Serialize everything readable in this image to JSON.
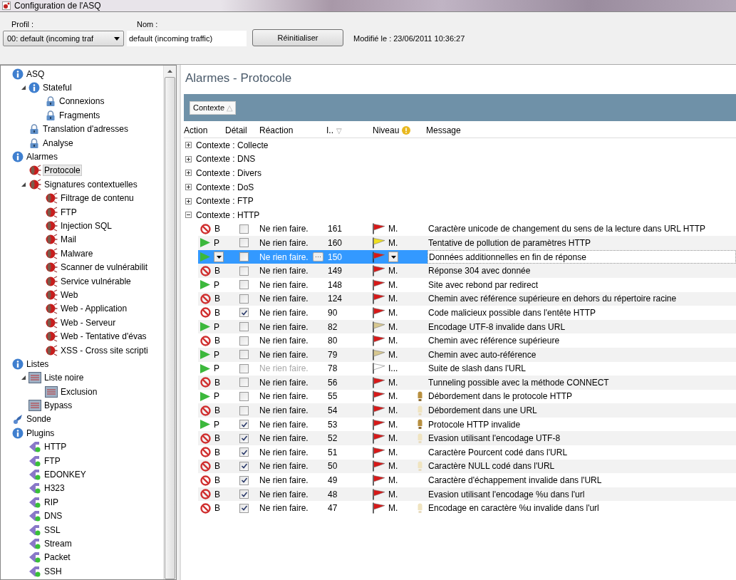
{
  "window": {
    "title": "Configuration de l'ASQ"
  },
  "profile": {
    "profile_label": "Profil :",
    "profile_value": "00: default (incoming traf",
    "name_label": "Nom :",
    "name_value": "default (incoming traffic)",
    "reset_button": "Réinitialiser",
    "modified": "Modifié le : 23/06/2011 10:36:27"
  },
  "tree": [
    {
      "label": "ASQ",
      "kind": "info",
      "selected": false,
      "children": [
        {
          "label": "Stateful",
          "kind": "info",
          "selected": false,
          "expanded": true,
          "children": [
            {
              "label": "Connexions",
              "kind": "lock",
              "selected": false
            },
            {
              "label": "Fragments",
              "kind": "lock",
              "selected": false
            }
          ]
        },
        {
          "label": "Translation d'adresses",
          "kind": "lock",
          "selected": false
        },
        {
          "label": "Analyse",
          "kind": "lock",
          "selected": false
        }
      ]
    },
    {
      "label": "Alarmes",
      "kind": "info",
      "selected": false,
      "children": [
        {
          "label": "Protocole",
          "kind": "alarm",
          "selected": true
        },
        {
          "label": "Signatures contextuelles",
          "kind": "alarm",
          "selected": false,
          "expanded": true,
          "children": [
            {
              "label": "Filtrage de contenu",
              "kind": "alarm",
              "selected": false
            },
            {
              "label": "FTP",
              "kind": "alarm",
              "selected": false
            },
            {
              "label": "Injection SQL",
              "kind": "alarm",
              "selected": false
            },
            {
              "label": "Mail",
              "kind": "alarm",
              "selected": false
            },
            {
              "label": "Malware",
              "kind": "alarm",
              "selected": false
            },
            {
              "label": "Scanner de vulnérabilit",
              "kind": "alarm",
              "selected": false
            },
            {
              "label": "Service vulnérable",
              "kind": "alarm",
              "selected": false
            },
            {
              "label": "Web",
              "kind": "alarm",
              "selected": false
            },
            {
              "label": "Web - Application",
              "kind": "alarm",
              "selected": false
            },
            {
              "label": "Web - Serveur",
              "kind": "alarm",
              "selected": false
            },
            {
              "label": "Web - Tentative d'évas",
              "kind": "alarm",
              "selected": false
            },
            {
              "label": "XSS - Cross site scripti",
              "kind": "alarm",
              "selected": false
            }
          ]
        }
      ]
    },
    {
      "label": "Listes",
      "kind": "info",
      "selected": false,
      "children": [
        {
          "label": "Liste noire",
          "kind": "list",
          "selected": false,
          "expanded": true,
          "children": [
            {
              "label": "Exclusion",
              "kind": "list",
              "selected": false
            }
          ]
        },
        {
          "label": "Bypass",
          "kind": "list",
          "selected": false
        }
      ]
    },
    {
      "label": "Sonde",
      "kind": "probe",
      "selected": false
    },
    {
      "label": "Plugins",
      "kind": "info",
      "selected": false,
      "children": [
        {
          "label": "HTTP",
          "kind": "plugin",
          "selected": false
        },
        {
          "label": "FTP",
          "kind": "plugin",
          "selected": false
        },
        {
          "label": "EDONKEY",
          "kind": "plugin",
          "selected": false
        },
        {
          "label": "H323",
          "kind": "plugin",
          "selected": false
        },
        {
          "label": "RIP",
          "kind": "plugin",
          "selected": false
        },
        {
          "label": "DNS",
          "kind": "plugin",
          "selected": false
        },
        {
          "label": "SSL",
          "kind": "plugin",
          "selected": false
        },
        {
          "label": "Stream",
          "kind": "plugin",
          "selected": false
        },
        {
          "label": "Packet",
          "kind": "plugin",
          "selected": false
        },
        {
          "label": "SSH",
          "kind": "plugin",
          "selected": false
        }
      ]
    }
  ],
  "panel": {
    "title": "Alarmes - Protocole",
    "group_by": {
      "label": "Contexte",
      "glyph": "△"
    },
    "columns": [
      {
        "label": "Action"
      },
      {
        "label": "Détail"
      },
      {
        "label": "Réaction"
      },
      {
        "label": "I..",
        "glyph": "▽"
      },
      {
        "label": "Niveau"
      },
      {
        "label": "Message"
      }
    ],
    "groups": [
      {
        "label": "Contexte : Collecte",
        "expanded": false
      },
      {
        "label": "Contexte : DNS",
        "expanded": false
      },
      {
        "label": "Contexte : Divers",
        "expanded": false
      },
      {
        "label": "Contexte : DoS",
        "expanded": false
      },
      {
        "label": "Contexte : FTP",
        "expanded": false
      },
      {
        "label": "Contexte : HTTP",
        "expanded": true,
        "rows": [
          {
            "kind": "block",
            "action_label": "B",
            "checked": false,
            "reaction": "Ne rien faire.",
            "disabled": false,
            "id": "161",
            "color": "#d81818",
            "level": "M.",
            "message": "Caractère unicode de changement du sens de la lecture dans URL HTTP",
            "selected": false
          },
          {
            "kind": "pass",
            "action_label": "P",
            "checked": false,
            "reaction": "Ne rien faire.",
            "disabled": false,
            "id": "160",
            "color": "#f0e020",
            "level": "M.",
            "message": "Tentative de pollution de paramètres HTTP",
            "selected": false
          },
          {
            "kind": "pass",
            "checked": false,
            "reaction": "Ne rien faire.",
            "edit_glyph": "···",
            "disabled": false,
            "id": "150",
            "color": "#d81818",
            "message": "Données additionnelles en fin de réponse",
            "selected": true
          },
          {
            "kind": "block",
            "action_label": "B",
            "checked": false,
            "reaction": "Ne rien faire.",
            "disabled": false,
            "id": "149",
            "color": "#d81818",
            "level": "M.",
            "message": "Réponse 304 avec donnée",
            "selected": false
          },
          {
            "kind": "pass",
            "action_label": "P",
            "checked": false,
            "reaction": "Ne rien faire.",
            "disabled": false,
            "id": "148",
            "color": "#d81818",
            "level": "M.",
            "message": "Site avec rebond par redirect",
            "selected": false
          },
          {
            "kind": "block",
            "action_label": "B",
            "checked": false,
            "reaction": "Ne rien faire.",
            "disabled": false,
            "id": "124",
            "color": "#d81818",
            "level": "M.",
            "message": "Chemin avec référence supérieure en dehors du répertoire racine",
            "selected": false
          },
          {
            "kind": "block",
            "action_label": "B",
            "checked": true,
            "reaction": "Ne rien faire.",
            "disabled": false,
            "id": "90",
            "color": "#d81818",
            "level": "M.",
            "message": "Code malicieux possible dans l'entête HTTP",
            "selected": false
          },
          {
            "kind": "pass",
            "action_label": "P",
            "checked": false,
            "reaction": "Ne rien faire.",
            "disabled": false,
            "id": "82",
            "color": "#d8c890",
            "level": "M.",
            "message": "Encodage UTF-8 invalide dans URL",
            "selected": false
          },
          {
            "kind": "block",
            "action_label": "B",
            "checked": false,
            "reaction": "Ne rien faire.",
            "disabled": false,
            "id": "80",
            "color": "#d81818",
            "level": "M.",
            "message": "Chemin avec référence supérieure",
            "selected": false
          },
          {
            "kind": "pass",
            "action_label": "P",
            "checked": false,
            "reaction": "Ne rien faire.",
            "disabled": false,
            "id": "79",
            "color": "#d8c890",
            "level": "M.",
            "message": "Chemin avec auto-référence",
            "selected": false
          },
          {
            "kind": "pass",
            "action_label": "P",
            "checked": false,
            "reaction": "Ne rien faire.",
            "disabled": true,
            "id": "78",
            "color": "#ffffff",
            "level": "I...",
            "message": "Suite de slash dans l'URL",
            "selected": false
          },
          {
            "kind": "block",
            "action_label": "B",
            "checked": false,
            "reaction": "Ne rien faire.",
            "disabled": false,
            "id": "56",
            "color": "#d81818",
            "level": "M.",
            "message": "Tunneling possible avec la méthode CONNECT",
            "selected": false
          },
          {
            "kind": "pass",
            "action_label": "P",
            "checked": false,
            "reaction": "Ne rien faire.",
            "disabled": false,
            "id": "55",
            "color": "#d81818",
            "level": "M.",
            "bulb": true,
            "lit": true,
            "message": "Débordement dans le protocole HTTP",
            "selected": false
          },
          {
            "kind": "block",
            "action_label": "B",
            "checked": false,
            "reaction": "Ne rien faire.",
            "disabled": false,
            "id": "54",
            "color": "#d81818",
            "level": "M.",
            "bulb": true,
            "lit": false,
            "message": "Débordement dans une URL",
            "selected": false
          },
          {
            "kind": "pass",
            "action_label": "P",
            "checked": true,
            "reaction": "Ne rien faire.",
            "disabled": false,
            "id": "53",
            "color": "#d81818",
            "level": "M.",
            "bulb": true,
            "lit": true,
            "message": "Protocole HTTP invalide",
            "selected": false
          },
          {
            "kind": "block",
            "action_label": "B",
            "checked": true,
            "reaction": "Ne rien faire.",
            "disabled": false,
            "id": "52",
            "color": "#d81818",
            "level": "M.",
            "bulb": true,
            "lit": false,
            "message": "Evasion utilisant l'encodage UTF-8",
            "selected": false
          },
          {
            "kind": "block",
            "action_label": "B",
            "checked": true,
            "reaction": "Ne rien faire.",
            "disabled": false,
            "id": "51",
            "color": "#d81818",
            "level": "M.",
            "message": "Caractère Pourcent codé dans l'URL",
            "selected": false
          },
          {
            "kind": "block",
            "action_label": "B",
            "checked": true,
            "reaction": "Ne rien faire.",
            "disabled": false,
            "id": "50",
            "color": "#d81818",
            "level": "M.",
            "bulb": true,
            "lit": false,
            "message": "Caractère NULL codé dans l'URL",
            "selected": false
          },
          {
            "kind": "block",
            "action_label": "B",
            "checked": true,
            "reaction": "Ne rien faire.",
            "disabled": false,
            "id": "49",
            "color": "#d81818",
            "level": "M.",
            "message": "Caractère d'échappement invalide dans l'URL",
            "selected": false
          },
          {
            "kind": "block",
            "action_label": "B",
            "checked": true,
            "reaction": "Ne rien faire.",
            "disabled": false,
            "id": "48",
            "color": "#d81818",
            "level": "M.",
            "message": "Evasion utilisant l'encodage %u dans l'url",
            "selected": false
          },
          {
            "kind": "block",
            "action_label": "B",
            "checked": true,
            "reaction": "Ne rien faire.",
            "disabled": false,
            "id": "47",
            "color": "#d81818",
            "level": "M.",
            "bulb": true,
            "lit": false,
            "message": "Encodage en caractère %u invalide dans l'url",
            "selected": false
          }
        ]
      }
    ]
  }
}
